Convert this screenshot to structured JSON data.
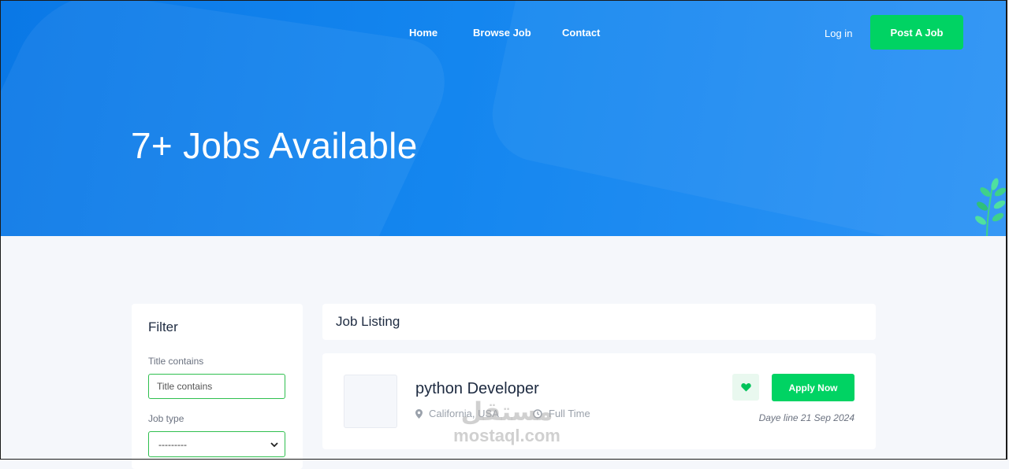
{
  "nav": {
    "items": [
      "Home",
      "Browse Job",
      "Contact"
    ],
    "login_label": "Log in",
    "post_job_label": "Post A Job"
  },
  "hero": {
    "title": "7+ Jobs Available"
  },
  "filter": {
    "title": "Filter",
    "title_contains_label": "Title contains",
    "title_contains_placeholder": "Title contains",
    "title_contains_value": "",
    "job_type_label": "Job type",
    "job_type_selected": "---------"
  },
  "listing": {
    "heading": "Job Listing",
    "jobs": [
      {
        "title": "python Developer",
        "location": "California, USA",
        "type": "Full Time",
        "apply_label": "Apply Now",
        "deadline": "Daye line 21 Sep 2024"
      }
    ]
  },
  "watermark": {
    "arabic": "مستقل",
    "latin": "mostaql.com"
  },
  "colors": {
    "hero_blue": "#1486ef",
    "accent_green": "#00d363",
    "input_border": "#2fbf4f"
  },
  "icons": [
    "location-pin-icon",
    "clock-icon",
    "heart-icon",
    "chevron-down-icon",
    "plant-decoration"
  ]
}
